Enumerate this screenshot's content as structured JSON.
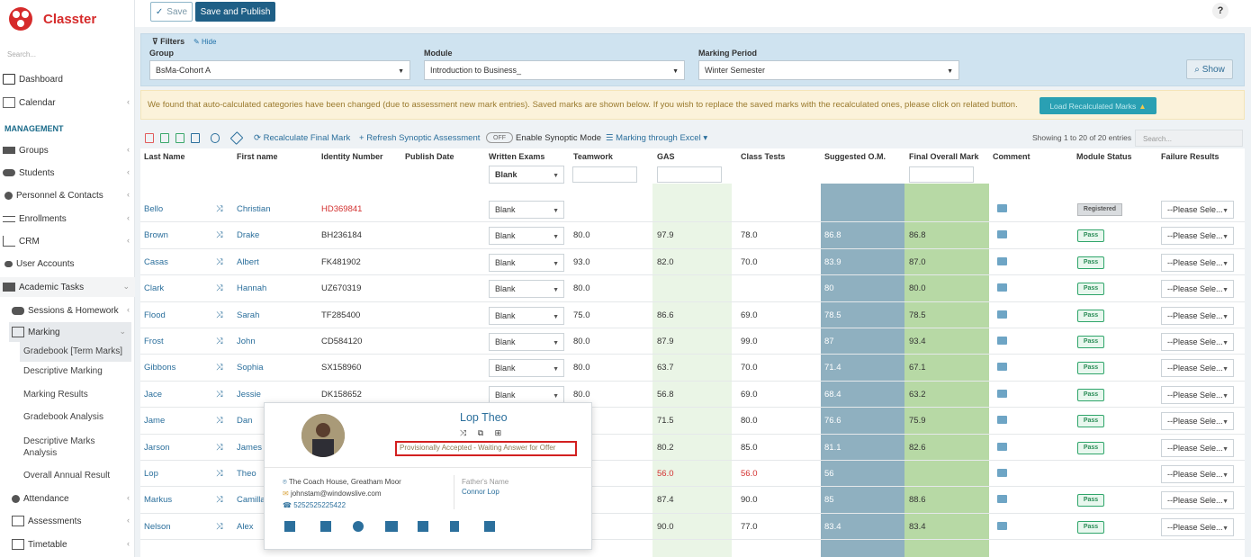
{
  "app": {
    "name": "Classter",
    "search_placeholder": "Search..."
  },
  "sidebar": {
    "dashboard": "Dashboard",
    "calendar": "Calendar",
    "management": "MANAGEMENT",
    "groups": "Groups",
    "students": "Students",
    "personnel": "Personnel & Contacts",
    "enrollments": "Enrollments",
    "crm": "CRM",
    "user_accounts": "User Accounts",
    "academic_tasks": "Academic Tasks",
    "sessions": "Sessions & Homework",
    "marking": "Marking",
    "gradebook_term": "Gradebook [Term Marks]",
    "descriptive_marking": "Descriptive Marking",
    "marking_results": "Marking Results",
    "gradebook_analysis": "Gradebook Analysis",
    "descriptive_marks_analysis": "Descriptive Marks Analysis",
    "overall_annual": "Overall Annual Result",
    "attendance": "Attendance",
    "assessments": "Assessments",
    "timetable": "Timetable"
  },
  "topbar": {
    "save": "Save",
    "save_publish": "Save and Publish",
    "help": "?"
  },
  "filters": {
    "title": "Filters",
    "hide": "Hide",
    "group_label": "Group",
    "group_value": "BsMa-Cohort A",
    "module_label": "Module",
    "module_value": "Introduction to Business_",
    "period_label": "Marking Period",
    "period_value": "Winter Semester",
    "show": "Show"
  },
  "warning": {
    "text": "We found that auto-calculated categories have been changed (due to assessment new mark entries). Saved marks are shown below. If you wish to replace the saved marks with the recalculated ones, please click on related button.",
    "button": "Load Recalculated Marks"
  },
  "toolbar": {
    "recalc": "Recalculate Final Mark",
    "refresh": "Refresh Synoptic Assessment",
    "toggle": "OFF",
    "enable": "Enable Synoptic Mode",
    "excel": "Marking through Excel",
    "info": "Showing 1 to 20 of 20 entries",
    "search_placeholder": "Search..."
  },
  "table": {
    "headers": {
      "last": "Last Name",
      "first": "First name",
      "id": "Identity Number",
      "pub": "Publish Date",
      "written": "Written Exams",
      "team": "Teamwork",
      "gas": "GAS",
      "class": "Class Tests",
      "sug": "Suggested O.M.",
      "final": "Final Overall Mark",
      "comment": "Comment",
      "status": "Module Status",
      "failure": "Failure Results"
    },
    "filter_blank": "Blank",
    "rows": [
      {
        "last": "Bello",
        "first": "Christian",
        "id": "HD369841",
        "id_red": true,
        "written": "Blank",
        "team": "",
        "gas": "",
        "cls": "",
        "sug": "",
        "final": "",
        "status": "Registered",
        "failure": "--Please Sele..."
      },
      {
        "last": "Brown",
        "first": "Drake",
        "id": "BH236184",
        "written": "Blank",
        "team": "80.0",
        "gas": "97.9",
        "cls": "78.0",
        "sug": "86.8",
        "final": "86.8",
        "status": "Pass",
        "failure": "--Please Sele..."
      },
      {
        "last": "Casas",
        "first": "Albert",
        "id": "FK481902",
        "written": "Blank",
        "team": "93.0",
        "gas": "82.0",
        "cls": "70.0",
        "sug": "83.9",
        "final": "87.0",
        "status": "Pass",
        "failure": "--Please Sele..."
      },
      {
        "last": "Clark",
        "first": "Hannah",
        "id": "UZ670319",
        "written": "Blank",
        "team": "80.0",
        "gas": "",
        "cls": "",
        "sug": "80",
        "final": "80.0",
        "status": "Pass",
        "failure": "--Please Sele..."
      },
      {
        "last": "Flood",
        "first": "Sarah",
        "id": "TF285400",
        "written": "Blank",
        "team": "75.0",
        "gas": "86.6",
        "cls": "69.0",
        "sug": "78.5",
        "final": "78.5",
        "status": "Pass",
        "failure": "--Please Sele..."
      },
      {
        "last": "Frost",
        "first": "John",
        "id": "CD584120",
        "written": "Blank",
        "team": "80.0",
        "gas": "87.9",
        "cls": "99.0",
        "sug": "87",
        "final": "93.4",
        "status": "Pass",
        "failure": "--Please Sele..."
      },
      {
        "last": "Gibbons",
        "first": "Sophia",
        "id": "SX158960",
        "written": "Blank",
        "team": "80.0",
        "gas": "63.7",
        "cls": "70.0",
        "sug": "71.4",
        "final": "67.1",
        "status": "Pass",
        "failure": "--Please Sele..."
      },
      {
        "last": "Jace",
        "first": "Jessie",
        "id": "DK158652",
        "written": "Blank",
        "team": "80.0",
        "gas": "56.8",
        "cls": "69.0",
        "sug": "68.4",
        "final": "63.2",
        "status": "Pass",
        "failure": "--Please Sele..."
      },
      {
        "last": "Jame",
        "first": "Dan",
        "id": "",
        "written": "",
        "team": "",
        "gas": "71.5",
        "cls": "80.0",
        "sug": "76.6",
        "final": "75.9",
        "status": "Pass",
        "failure": "--Please Sele..."
      },
      {
        "last": "Jarson",
        "first": "James",
        "id": "",
        "written": "",
        "team": "",
        "gas": "80.2",
        "cls": "85.0",
        "sug": "81.1",
        "final": "82.6",
        "status": "Pass",
        "failure": "--Please Sele..."
      },
      {
        "last": "Lop",
        "first": "Theo",
        "id": "",
        "written": "",
        "team": "",
        "gas": "56.0",
        "gas_red": true,
        "cls": "56.0",
        "cls_red": true,
        "sug": "56",
        "final": "",
        "status": "",
        "failure": "--Please Sele..."
      },
      {
        "last": "Markus",
        "first": "Camilla",
        "id": "",
        "written": "",
        "team": "",
        "gas": "87.4",
        "cls": "90.0",
        "sug": "85",
        "final": "88.6",
        "status": "Pass",
        "failure": "--Please Sele..."
      },
      {
        "last": "Nelson",
        "first": "Alex",
        "id": "",
        "written": "",
        "team": "",
        "gas": "90.0",
        "cls": "77.0",
        "sug": "83.4",
        "final": "83.4",
        "status": "Pass",
        "failure": "--Please Sele..."
      }
    ]
  },
  "popup": {
    "name": "Lop Theo",
    "status": "Provisionally Accepted - Waiting Answer for Offer",
    "address": "The Coach House, Greatham Moor",
    "email": "johnstam@windowslive.com",
    "phone": "5252525225422",
    "father_label": "Father's Name",
    "father": "Connor Lop"
  }
}
